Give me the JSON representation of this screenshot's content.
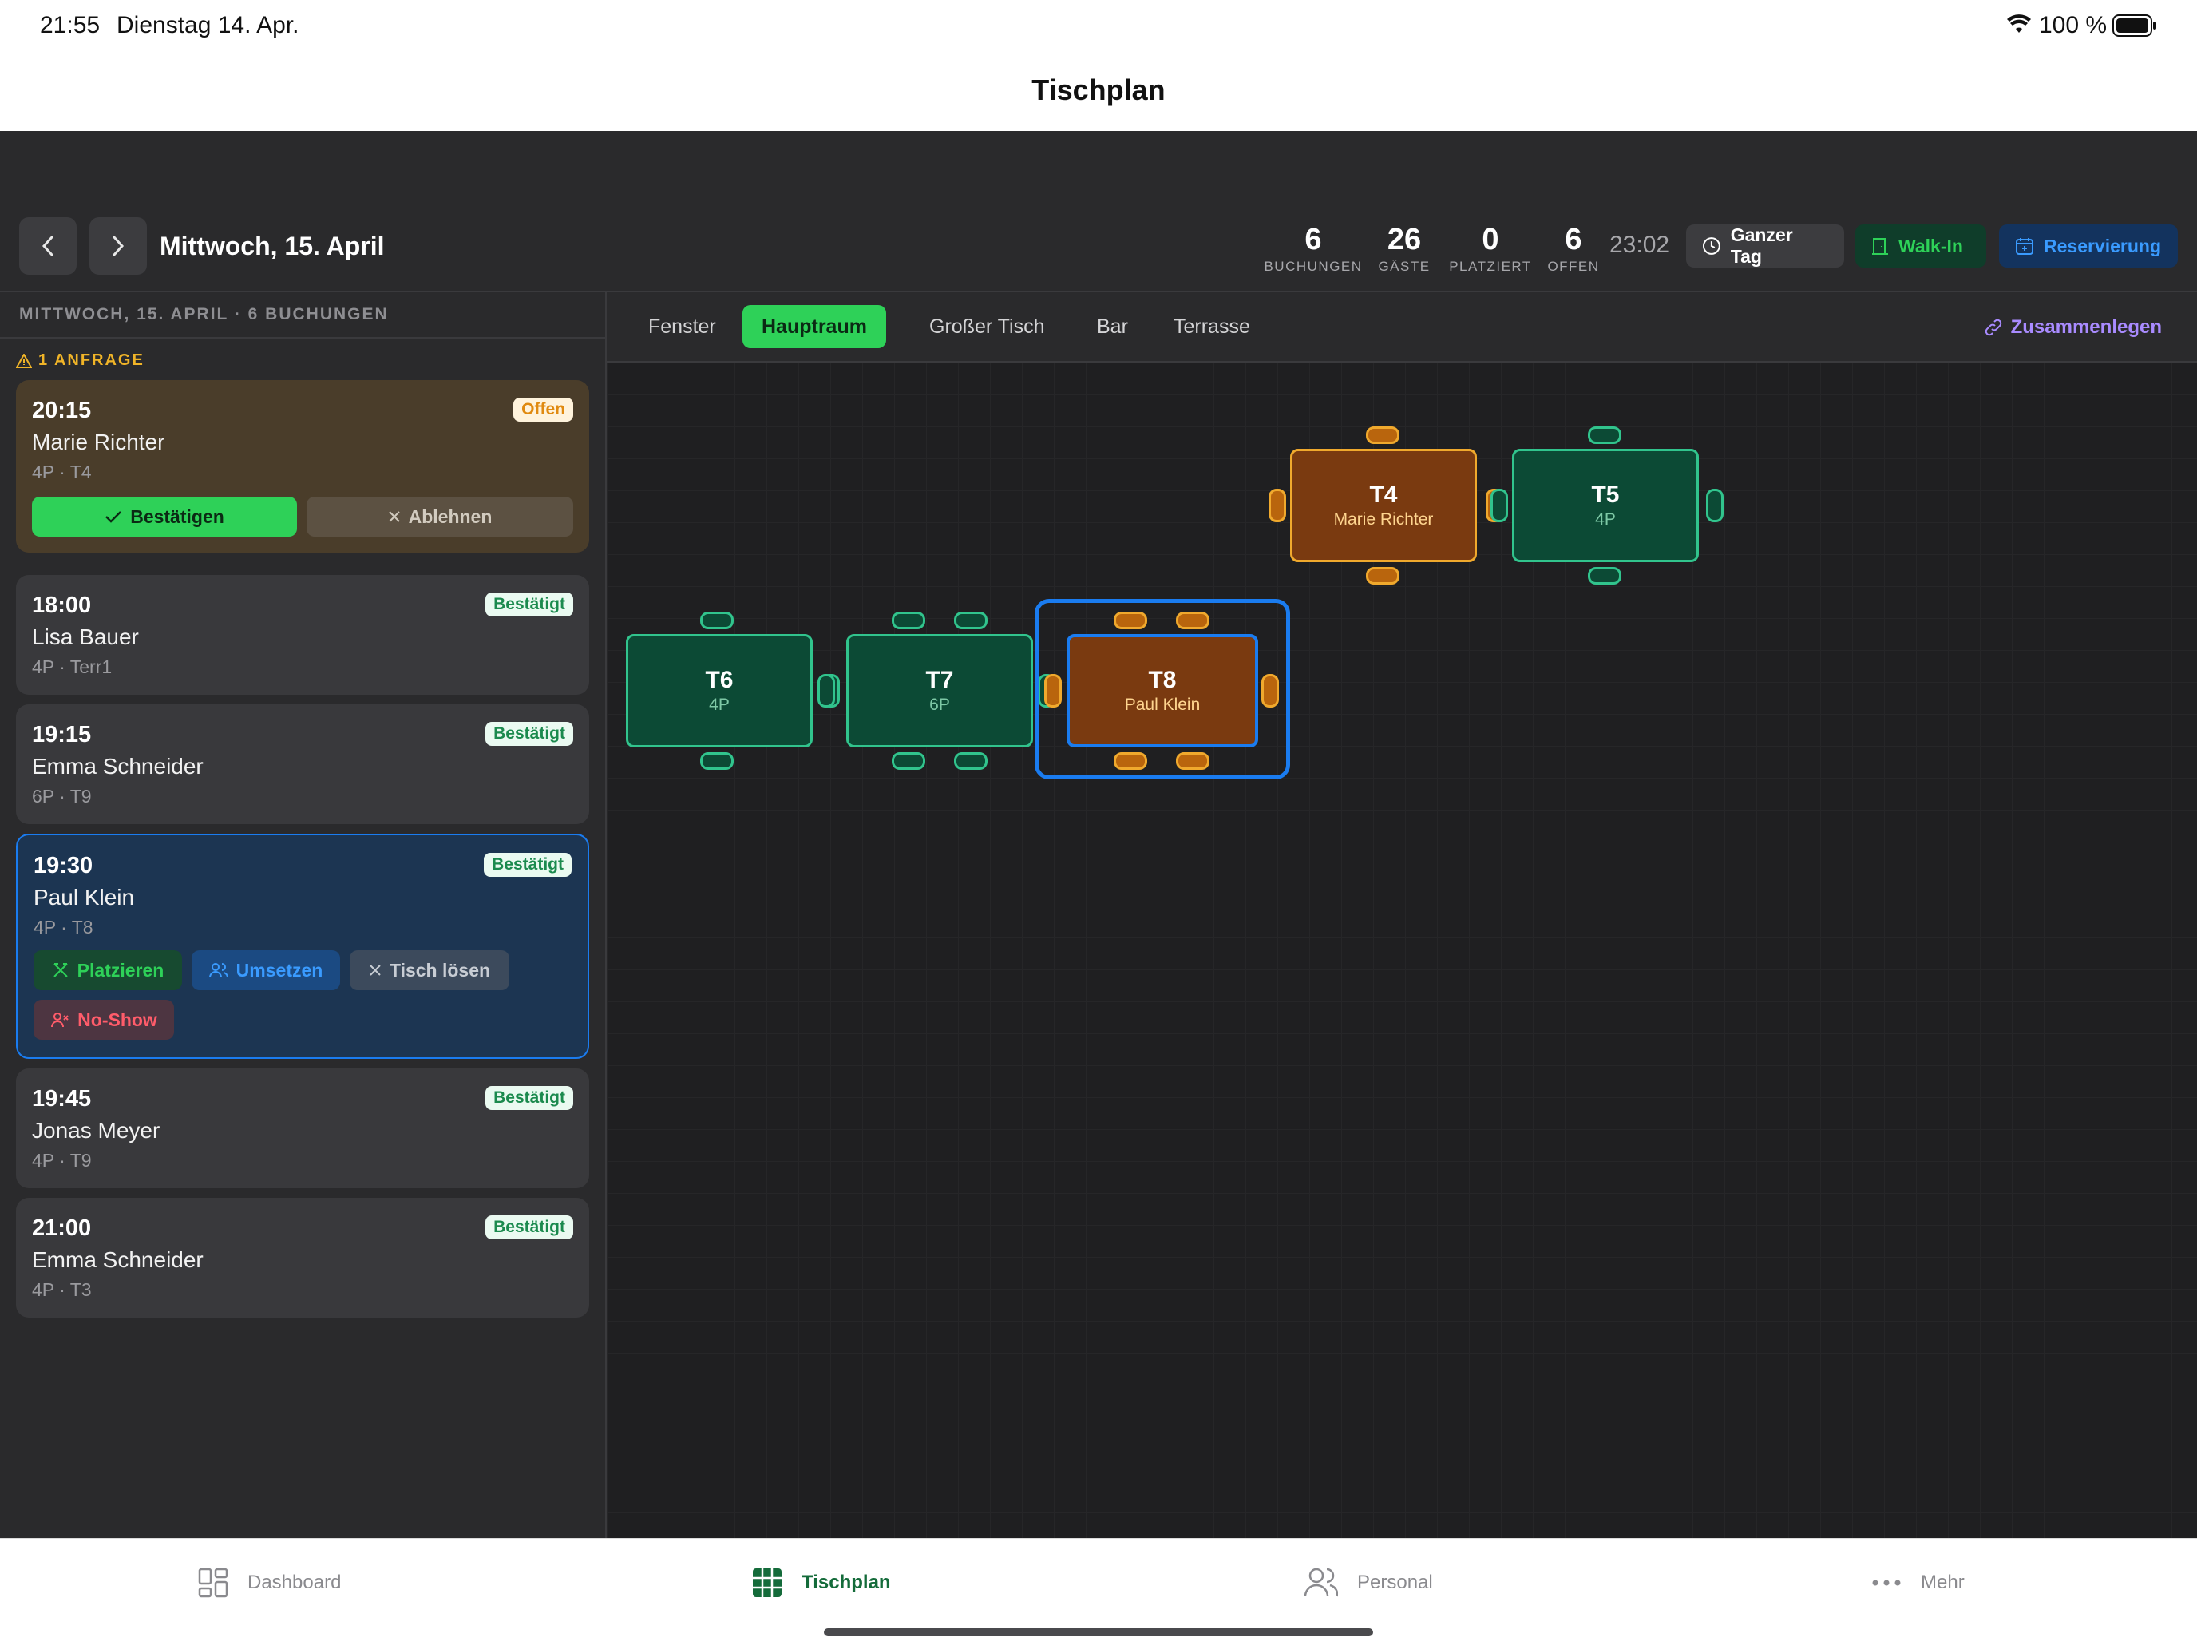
{
  "status_bar": {
    "time": "21:55",
    "date": "Dienstag 14. Apr.",
    "battery": "100 %"
  },
  "title": "Tischplan",
  "header": {
    "date_label": "Mittwoch, 15. April",
    "stats": [
      {
        "value": "6",
        "label": "BUCHUNGEN"
      },
      {
        "value": "26",
        "label": "GÄSTE"
      },
      {
        "value": "0",
        "label": "PLATZIERT"
      },
      {
        "value": "6",
        "label": "OFFEN"
      }
    ],
    "clock": "23:02",
    "ganzer_tag": "Ganzer Tag",
    "walk_in": "Walk-In",
    "reservierung": "Reservierung"
  },
  "sidebar": {
    "heading": "MITTWOCH, 15. APRIL · 6 BUCHUNGEN",
    "request_label": "1 ANFRAGE",
    "request": {
      "time": "20:15",
      "name": "Marie Richter",
      "meta": "4P · T4",
      "badge": "Offen",
      "confirm": "Bestätigen",
      "decline": "Ablehnen"
    },
    "bookings": [
      {
        "time": "18:00",
        "name": "Lisa Bauer",
        "meta": "4P · Terr1",
        "badge": "Bestätigt"
      },
      {
        "time": "19:15",
        "name": "Emma Schneider",
        "meta": "6P · T9",
        "badge": "Bestätigt"
      },
      {
        "time": "19:30",
        "name": "Paul Klein",
        "meta": "4P · T8",
        "badge": "Bestätigt"
      },
      {
        "time": "19:45",
        "name": "Jonas Meyer",
        "meta": "4P · T9",
        "badge": "Bestätigt"
      },
      {
        "time": "21:00",
        "name": "Emma Schneider",
        "meta": "4P · T3",
        "badge": "Bestätigt"
      }
    ],
    "actions": {
      "platzieren": "Platzieren",
      "umsetzen": "Umsetzen",
      "tisch_loesen": "Tisch lösen",
      "no_show": "No-Show"
    }
  },
  "rooms": {
    "tabs": [
      "Fenster",
      "Hauptraum",
      "Großer Tisch",
      "Bar",
      "Terrasse"
    ],
    "active": "Hauptraum",
    "merge": "Zusammenlegen"
  },
  "tables": [
    {
      "id": "T4",
      "sub": "Marie Richter",
      "status": "occupied"
    },
    {
      "id": "T5",
      "sub": "4P",
      "status": "free"
    },
    {
      "id": "T6",
      "sub": "4P",
      "status": "free"
    },
    {
      "id": "T7",
      "sub": "6P",
      "status": "free"
    },
    {
      "id": "T8",
      "sub": "Paul Klein",
      "status": "occupied",
      "selected": true
    }
  ],
  "colors": {
    "free": "#31c48d",
    "occupied": "#f0a92d",
    "selected": "#1a7cf0",
    "accent_green": "#2ed158"
  },
  "tab_bar": {
    "items": [
      "Dashboard",
      "Tischplan",
      "Personal",
      "Mehr"
    ],
    "active": "Tischplan"
  }
}
